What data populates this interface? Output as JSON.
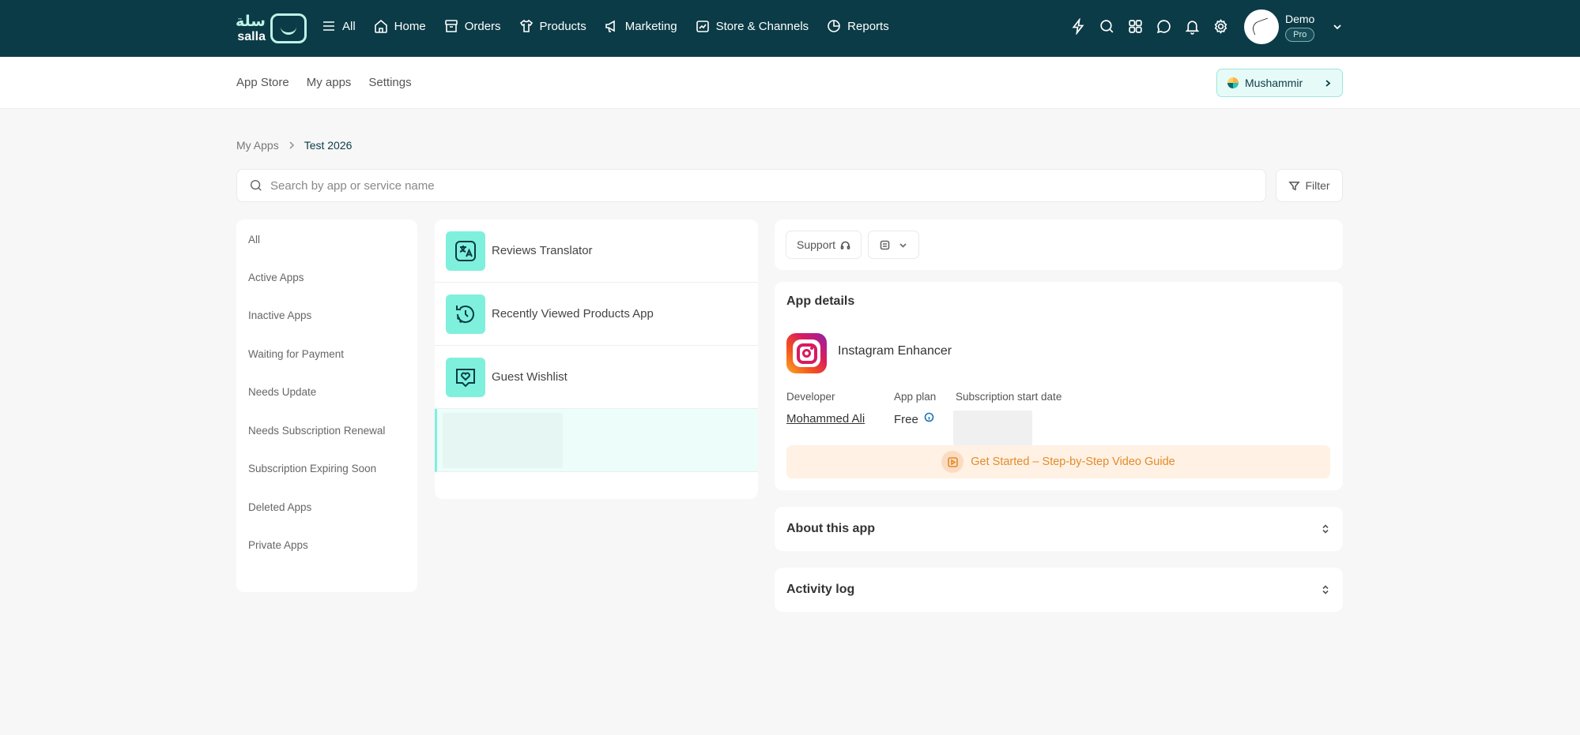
{
  "logo": {
    "arabic": "سلة",
    "latin": "salla"
  },
  "nav": {
    "items": [
      {
        "label": "All",
        "icon": "menu-icon"
      },
      {
        "label": "Home",
        "icon": "home-icon"
      },
      {
        "label": "Orders",
        "icon": "orders-icon"
      },
      {
        "label": "Products",
        "icon": "products-icon"
      },
      {
        "label": "Marketing",
        "icon": "marketing-icon"
      },
      {
        "label": "Store & Channels",
        "icon": "store-channels-icon"
      },
      {
        "label": "Reports",
        "icon": "reports-icon"
      }
    ]
  },
  "header_icons": [
    "lightning-icon",
    "search-icon",
    "apps-grid-icon",
    "chat-icon",
    "bell-icon",
    "gear-icon"
  ],
  "user": {
    "name": "Demo",
    "plan": "Pro"
  },
  "subnav": {
    "tabs": [
      "App Store",
      "My apps",
      "Settings"
    ],
    "store_name": "Mushammir"
  },
  "breadcrumb": {
    "root": "My Apps",
    "current": "Test 2026"
  },
  "search": {
    "placeholder": "Search by app or service name",
    "value": ""
  },
  "filter": {
    "label": "Filter"
  },
  "status_filters": [
    "All",
    "Active Apps",
    "Inactive Apps",
    "Waiting for Payment",
    "Needs Update",
    "Needs Subscription Renewal",
    "Subscription Expiring Soon",
    "Deleted Apps",
    "Private Apps"
  ],
  "apps": [
    {
      "name": "Reviews Translator",
      "icon": "translate-icon"
    },
    {
      "name": "Recently Viewed Products App",
      "icon": "history-icon"
    },
    {
      "name": "Guest Wishlist",
      "icon": "heart-chat-icon"
    }
  ],
  "toolbar": {
    "support_label": "Support"
  },
  "details": {
    "section_title": "App details",
    "app_name": "Instagram Enhancer",
    "developer_label": "Developer",
    "developer_value": "Mohammed Ali",
    "plan_label": "App plan",
    "plan_value": "Free",
    "start_label": "Subscription start date",
    "guide_label": "Get Started – Step-by-Step Video Guide"
  },
  "accordions": {
    "about": "About this app",
    "log": "Activity log"
  },
  "colors": {
    "header_bg": "#0b3b47",
    "accent": "#7ff0dc",
    "guide_text": "#e38b2a"
  }
}
